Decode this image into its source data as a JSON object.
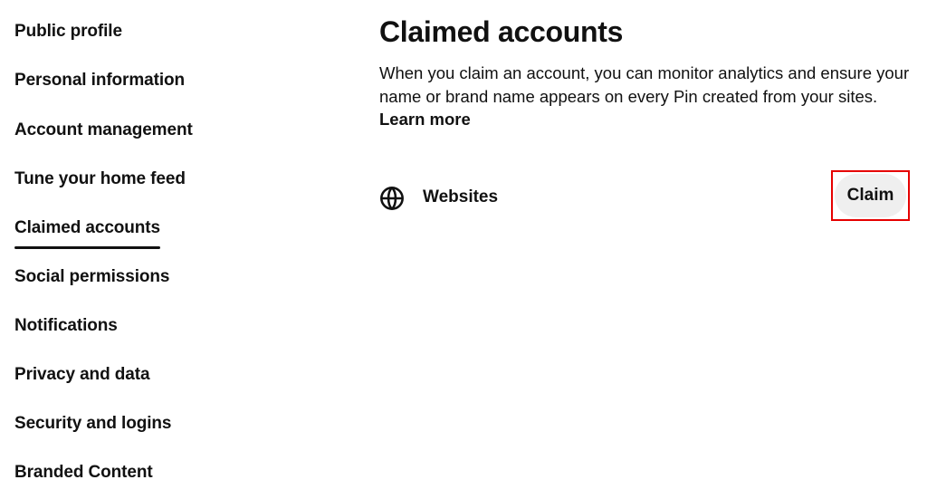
{
  "sidebar": {
    "items": [
      {
        "label": "Public profile",
        "active": false
      },
      {
        "label": "Personal information",
        "active": false
      },
      {
        "label": "Account management",
        "active": false
      },
      {
        "label": "Tune your home feed",
        "active": false
      },
      {
        "label": "Claimed accounts",
        "active": true
      },
      {
        "label": "Social permissions",
        "active": false
      },
      {
        "label": "Notifications",
        "active": false
      },
      {
        "label": "Privacy and data",
        "active": false
      },
      {
        "label": "Security and logins",
        "active": false
      },
      {
        "label": "Branded Content",
        "active": false
      }
    ]
  },
  "main": {
    "title": "Claimed accounts",
    "description": "When you claim an account, you can monitor analytics and ensure your name or brand name appears on every Pin created from your sites.",
    "learn_more": "Learn more",
    "accounts": [
      {
        "icon": "globe-icon",
        "label": "Websites",
        "button_label": "Claim"
      }
    ]
  },
  "colors": {
    "text": "#111111",
    "button_bg": "#efefef",
    "highlight_box": "#e60000"
  }
}
